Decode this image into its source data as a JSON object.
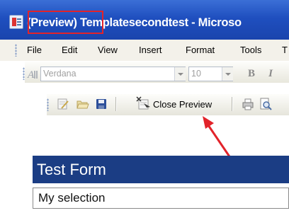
{
  "window": {
    "title_highlight": "(Preview)",
    "title_rest": " Templatesecondtest - Microso"
  },
  "menu": {
    "items": [
      {
        "label": "File"
      },
      {
        "label": "Edit"
      },
      {
        "label": "View"
      },
      {
        "label": "Insert"
      },
      {
        "label": "Format"
      },
      {
        "label": "Tools"
      },
      {
        "label": "T"
      }
    ]
  },
  "format_toolbar": {
    "font_value": "Verdana",
    "size_value": "10",
    "bold_label": "B",
    "italic_label": "I"
  },
  "standard_toolbar": {
    "close_preview_label": "Close Preview"
  },
  "form": {
    "title": "Test Form",
    "selection_text": "My selection"
  },
  "colors": {
    "titlebar": "#2352c4",
    "highlight_border": "#e2232a",
    "form_header": "#1b3d84",
    "arrow": "#e2232a"
  },
  "icons": [
    "app-icon",
    "font-icon",
    "edit-form-icon",
    "open-icon",
    "save-icon",
    "close-preview-icon",
    "print-icon",
    "print-preview-icon"
  ]
}
